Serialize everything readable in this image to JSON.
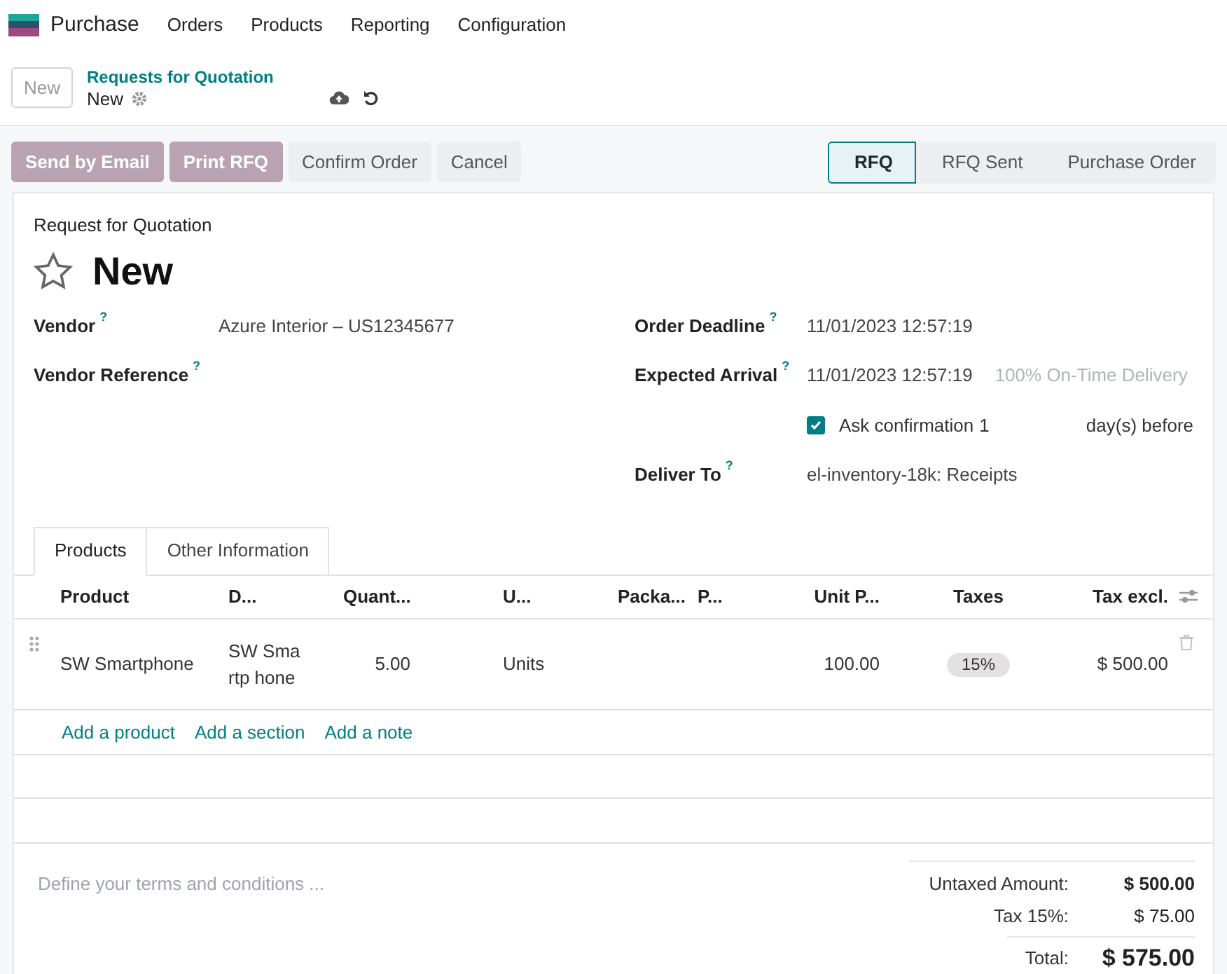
{
  "app": {
    "name": "Purchase",
    "menu": [
      "Orders",
      "Products",
      "Reporting",
      "Configuration"
    ]
  },
  "breadcrumb": {
    "new_button": "New",
    "parent": "Requests for Quotation",
    "current": "New"
  },
  "actions": [
    {
      "label": "Send by Email",
      "kind": "primary"
    },
    {
      "label": "Print RFQ",
      "kind": "primary"
    },
    {
      "label": "Confirm Order",
      "kind": "secondary"
    },
    {
      "label": "Cancel",
      "kind": "secondary"
    }
  ],
  "stages": [
    {
      "label": "RFQ",
      "selected": true
    },
    {
      "label": "RFQ Sent",
      "selected": false
    },
    {
      "label": "Purchase Order",
      "selected": false
    }
  ],
  "form": {
    "subtitle": "Request for Quotation",
    "title": "New",
    "starred": false,
    "left_fields": [
      {
        "label": "Vendor",
        "help": "?",
        "value": "Azure Interior – US12345677"
      },
      {
        "label": "Vendor Reference",
        "help": "?"
      }
    ],
    "right_fields": [
      {
        "label": "Order Deadline",
        "help": "?",
        "value": "11/01/2023 12:57:19"
      },
      {
        "label": "Expected Arrival",
        "help": "?",
        "value": "11/01/2023 12:57:19",
        "note": "100% On-Time Delivery"
      }
    ],
    "ask_confirmation": {
      "checked": true,
      "label": "Ask confirmation",
      "value": "1",
      "suffix": "day(s) before"
    },
    "deliver_to": {
      "label": "Deliver To",
      "help": "?",
      "value": "el-inventory-18k: Receipts"
    }
  },
  "tabs": [
    {
      "label": "Products",
      "selected": true
    },
    {
      "label": "Other Information",
      "selected": false
    }
  ],
  "table": {
    "columns": [
      "Product",
      "D...",
      "Quant...",
      "U...",
      "Packa...",
      "P...",
      "Unit P...",
      "Taxes",
      "Tax excl."
    ],
    "rows": [
      {
        "product": "SW Smartphone",
        "description": "SW Smartp hone",
        "quantity": "5.00",
        "unit": "Units",
        "unit_price": "100.00",
        "taxes": "15%",
        "subtotal": "$ 500.00"
      }
    ],
    "add_links": [
      "Add a product",
      "Add a section",
      "Add a note"
    ]
  },
  "terms": {
    "placeholder": "Define your terms and conditions ..."
  },
  "totals": [
    {
      "label": "Untaxed Amount:",
      "value": "$ 500.00",
      "kind": "untaxed"
    },
    {
      "label": "Tax 15%:",
      "value": "$ 75.00",
      "kind": "tax"
    },
    {
      "label": "Total:",
      "value": "$ 575.00",
      "kind": "total"
    }
  ]
}
